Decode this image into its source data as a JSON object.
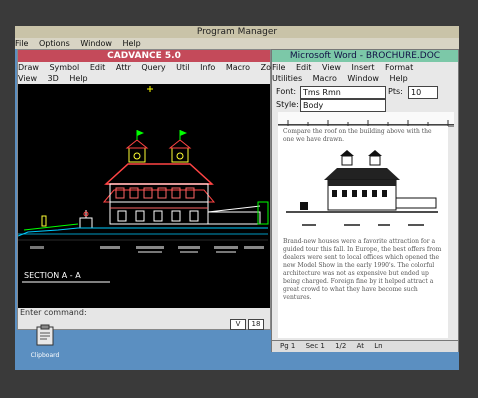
{
  "program_manager": {
    "title": "Program Manager",
    "menu": [
      "File",
      "Options",
      "Window",
      "Help"
    ]
  },
  "cadvance": {
    "title": "CADVANCE 5.0",
    "menu": [
      "Draw",
      "Symbol",
      "Edit",
      "Attr",
      "Query",
      "Util",
      "Info",
      "Macro",
      "Zoom"
    ],
    "menu2": [
      "View",
      "3D",
      "Help"
    ],
    "section_label": "SECTION A - A",
    "command_prompt": "Enter command:",
    "command_field": "V",
    "command_value": "18"
  },
  "word": {
    "title": "Microsoft Word - BROCHURE.DOC",
    "menu1": [
      "File",
      "Edit",
      "View",
      "Insert",
      "Format"
    ],
    "menu2": [
      "Utilities",
      "Macro",
      "Window",
      "Help"
    ],
    "font_label": "Font:",
    "font_value": "Tms Rmn",
    "pts_label": "Pts:",
    "pts_value": "10",
    "style_label": "Style:",
    "style_value": "Body",
    "doc_heading": "Compare the roof on the building above with the one we have drawn.",
    "doc_para": "Brand-new houses were a favorite attraction for a guided tour this fall. In Europe, the best offers from dealers were sent to local offices which opened the new Model Show in the early 1990's. The colorful architecture was not as expensive but ended up being charged. Foreign fine by it helped attract a great crowd to what they have become such ventures.",
    "status": [
      "Pg 1",
      "Sec 1",
      "1/2",
      "At",
      "Ln"
    ]
  },
  "clipboard": {
    "label": "Clipboard"
  },
  "colors": {
    "desktop": "#5b8fc1",
    "cad_title": "#c44a5a",
    "word_title": "#7cc8a8",
    "cad_bg": "#000000"
  }
}
